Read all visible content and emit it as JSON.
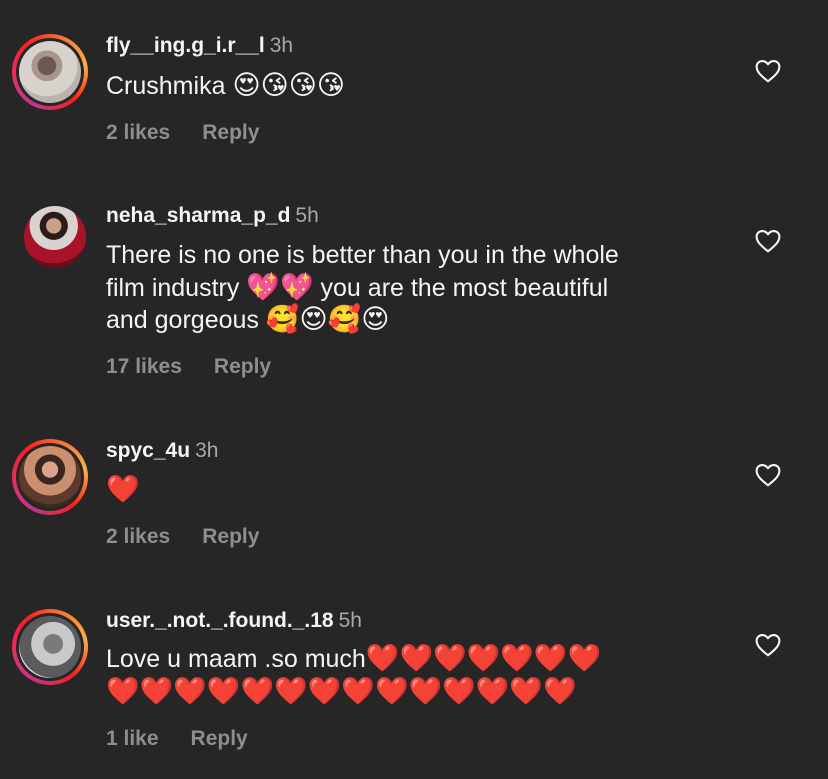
{
  "comments": [
    {
      "username": "fly__ing.g_i.r__l",
      "time": "3h",
      "text": "Crushmika",
      "emojis": "😍😘😘😘",
      "likes": "2 likes",
      "reply": "Reply"
    },
    {
      "username": "neha_sharma_p_d",
      "time": "5h",
      "line1": "There is no one is better than you in the whole",
      "line2_a": "film industry",
      "line2_emoji": "💖💖",
      "line2_b": "you are the most beautiful",
      "line3": "and gorgeous",
      "line3_emoji": "🥰😍🥰😍",
      "likes": "17 likes",
      "reply": "Reply"
    },
    {
      "username": "spyc_4u",
      "time": "3h",
      "emojis": "❤️",
      "likes": "2 likes",
      "reply": "Reply"
    },
    {
      "username": "user._.not._.found._.18",
      "time": "5h",
      "text": "Love u maam .so much",
      "emojis_line1": "❤️❤️❤️❤️❤️❤️❤️",
      "emojis_line2": "❤️❤️❤️❤️❤️❤️❤️❤️❤️❤️❤️❤️❤️❤️",
      "likes": "1 like",
      "reply": "Reply"
    }
  ],
  "icons": {
    "like": "heart-outline-icon"
  },
  "colors": {
    "background": "#262626",
    "primary_text": "#f5f5f5",
    "secondary_text": "#8e8e8e",
    "story_ring": "#e1306c"
  }
}
